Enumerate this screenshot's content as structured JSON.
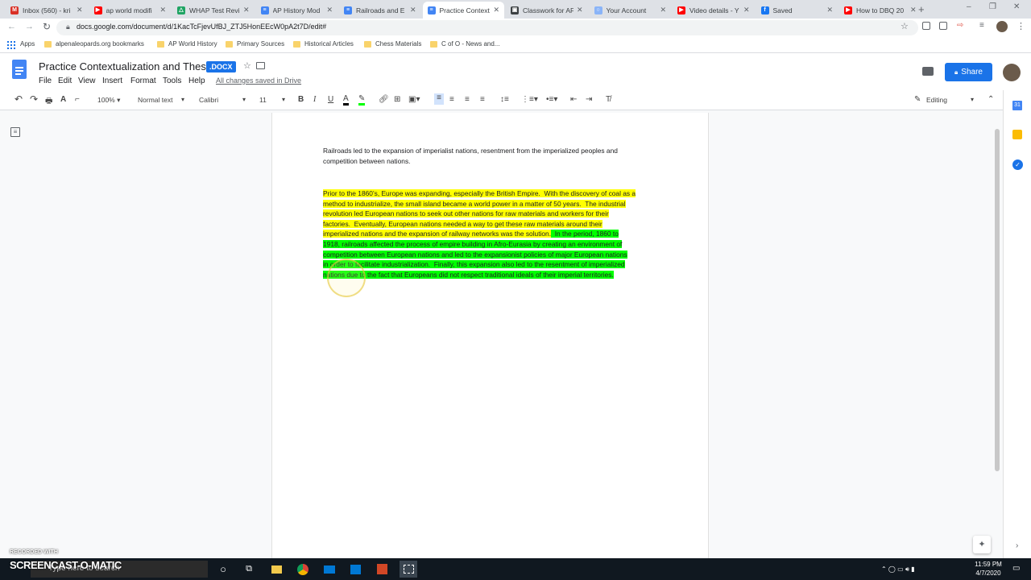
{
  "browser": {
    "tabs": [
      {
        "label": "Inbox (560) - kri",
        "favicon": "gmail-icon",
        "color": "#d93025",
        "glyph": "M"
      },
      {
        "label": "ap world modifi",
        "favicon": "youtube-icon",
        "color": "#ff0000",
        "glyph": "▶"
      },
      {
        "label": "WHAP Test Revi",
        "favicon": "drive-icon",
        "color": "#1fa463",
        "glyph": "△"
      },
      {
        "label": "AP History Mod",
        "favicon": "docs-icon",
        "color": "#4285f4",
        "glyph": "≡"
      },
      {
        "label": "Railroads and E",
        "favicon": "docs-icon",
        "color": "#4285f4",
        "glyph": "≡"
      },
      {
        "label": "Practice Context",
        "favicon": "docs-icon",
        "color": "#4285f4",
        "glyph": "≡"
      },
      {
        "label": "Classwork for AF",
        "favicon": "classroom-icon",
        "color": "#3c4043",
        "glyph": "▣"
      },
      {
        "label": "Your Account",
        "favicon": "account-icon",
        "color": "#8ab4f8",
        "glyph": "○"
      },
      {
        "label": "Video details - Y",
        "favicon": "youtube-icon",
        "color": "#ff0000",
        "glyph": "▶"
      },
      {
        "label": "Saved",
        "favicon": "facebook-icon",
        "color": "#1877f2",
        "glyph": "f"
      },
      {
        "label": "How to DBQ 20",
        "favicon": "youtube-icon",
        "color": "#ff0000",
        "glyph": "▶"
      }
    ],
    "url": "docs.google.com/document/d/1KacTcFjevUfBJ_ZTJ5HonEEcW0pA2t7D/edit#",
    "bookmarks": {
      "apps_label": "Apps",
      "items": [
        "alpenaleopards.org bookmarks",
        "AP World History",
        "Primary Sources",
        "Historical Articles",
        "Chess Materials",
        "C of O - News and..."
      ]
    }
  },
  "docs": {
    "title": "Practice Contextualization and Thesis",
    "badge": ".DOCX",
    "menu": [
      "File",
      "Edit",
      "View",
      "Insert",
      "Format",
      "Tools",
      "Help"
    ],
    "save_status": "All changes saved in Drive",
    "share_label": "Share",
    "toolbar": {
      "zoom": "100%",
      "style": "Normal text",
      "font": "Calibri",
      "size": "11",
      "mode": "Editing"
    },
    "body": {
      "para1": "Railroads led to the expansion of imperialist nations, resentment from the imperialized peoples and competition between nations.",
      "para2_lines": [
        [
          {
            "t": "Prior to the 1860’s, Europe was expanding, especially the British Empire.  With the discovery of coal as a",
            "hl": "y"
          }
        ],
        [
          {
            "t": "method to industrialize, the small island became a world power in a matter of 50 years.  The industrial",
            "hl": "y"
          }
        ],
        [
          {
            "t": "revolution led European nations to seek out other nations for raw materials and workers for their",
            "hl": "y"
          }
        ],
        [
          {
            "t": "factories.  Eventually, European nations needed a way to get these raw materials around their",
            "hl": "y"
          }
        ],
        [
          {
            "t": "imperialized nations and the expansion of railway networks was the solution.",
            "hl": "y"
          },
          {
            "t": "  In the period, 1860 to",
            "hl": "g"
          }
        ],
        [
          {
            "t": "1918, railroads affected the process of empire building in Afro-Eurasia by creating an environment of",
            "hl": "g"
          }
        ],
        [
          {
            "t": "competition between European nations and led to the expansionist policies of major European nations",
            "hl": "g"
          }
        ],
        [
          {
            "t": "in order to facilitate industrialization.  Finally, this expansion also led to the resentment of imperialized",
            "hl": "g"
          }
        ],
        [
          {
            "t": "nations due to the fact that Europeans did not respect traditional ideals of their imperial territories.",
            "hl": "g"
          }
        ]
      ]
    }
  },
  "taskbar": {
    "search_placeholder": "Type here to search",
    "time": "11:59 PM",
    "date": "4/7/2020",
    "watermark_top": "RECORDED WITH",
    "watermark_brand": "SCREENCAST-O-MATIC"
  },
  "colors": {
    "highlight_yellow": "#ffff00",
    "highlight_green": "#00ff00",
    "share_blue": "#1a73e8",
    "docs_blue": "#4285f4"
  }
}
